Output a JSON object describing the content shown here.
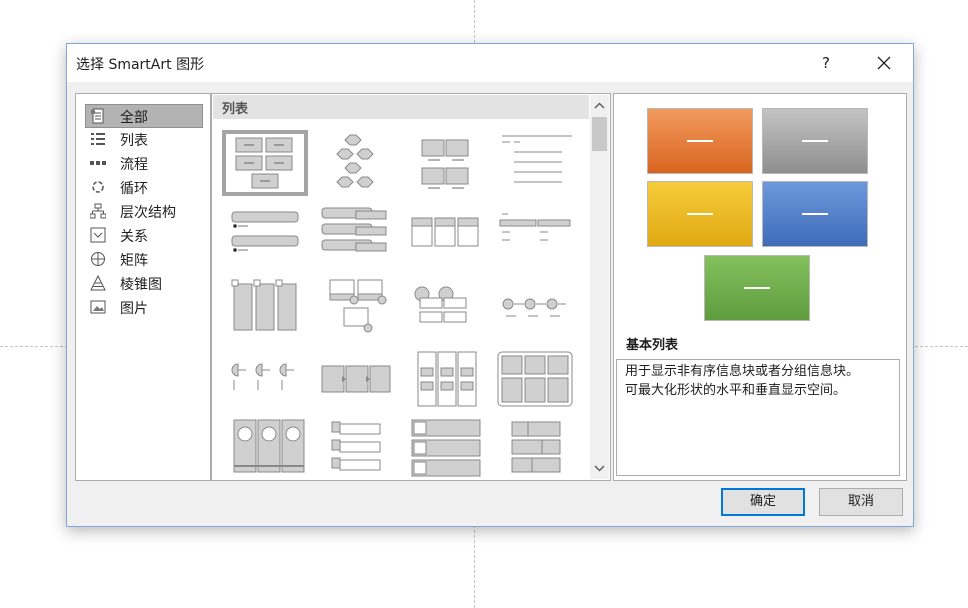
{
  "dialog": {
    "title": "选择 SmartArt 图形",
    "help_label": "?",
    "ok_label": "确定",
    "cancel_label": "取消"
  },
  "categories": [
    {
      "label": "全部",
      "icon": "all-icon",
      "selected": true
    },
    {
      "label": "列表",
      "icon": "list-icon"
    },
    {
      "label": "流程",
      "icon": "process-icon"
    },
    {
      "label": "循环",
      "icon": "cycle-icon"
    },
    {
      "label": "层次结构",
      "icon": "hierarchy-icon"
    },
    {
      "label": "关系",
      "icon": "relationship-icon"
    },
    {
      "label": "矩阵",
      "icon": "matrix-icon"
    },
    {
      "label": "棱锥图",
      "icon": "pyramid-icon"
    },
    {
      "label": "图片",
      "icon": "picture-icon"
    }
  ],
  "gallery": {
    "section_label": "列表"
  },
  "preview": {
    "name": "基本列表",
    "description_line1": "用于显示非有序信息块或者分组信息块。",
    "description_line2": "可最大化形状的水平和垂直显示空间。",
    "colors": [
      "#d8641f",
      "#8e8e8e",
      "#e0a912",
      "#3e6cb8",
      "#5e9c3e"
    ]
  }
}
